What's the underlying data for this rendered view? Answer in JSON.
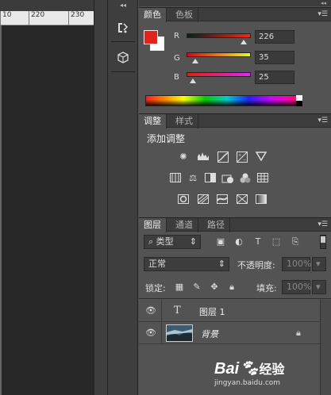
{
  "ruler": {
    "ticks": [
      "10",
      "220",
      "230"
    ]
  },
  "dock": {
    "grip": "◂◂"
  },
  "color_panel": {
    "tabs": [
      "颜色",
      "色板"
    ],
    "active_tab": 0,
    "foreground": "#e22319",
    "background": "#ffffff",
    "channels": [
      {
        "label": "R",
        "value": "226",
        "fraction": 0.886,
        "gradient": "linear-gradient(to right, #002319, #ff2319)"
      },
      {
        "label": "G",
        "value": "35",
        "fraction": 0.137,
        "gradient": "linear-gradient(to right, #e20019, #e2ff19)"
      },
      {
        "label": "B",
        "value": "25",
        "fraction": 0.098,
        "gradient": "linear-gradient(to right, #e22300, #e223ff)"
      }
    ]
  },
  "adjust_panel": {
    "tabs": [
      "调整",
      "样式"
    ],
    "active_tab": 0,
    "title": "添加调整",
    "icons_row1": [
      "brightness-icon",
      "levels-icon",
      "curves-icon",
      "exposure-icon",
      "vibrance-icon"
    ],
    "icons_row2": [
      "hue-saturation-icon",
      "color-balance-icon",
      "black-white-icon",
      "photo-filter-icon",
      "channel-mixer-icon",
      "color-lookup-icon"
    ],
    "icons_row3": [
      "invert-icon",
      "posterize-icon",
      "threshold-icon",
      "selective-color-icon",
      "gradient-map-icon"
    ]
  },
  "layers_panel": {
    "tabs": [
      "图层",
      "通道",
      "路径"
    ],
    "active_tab": 0,
    "filter_kind": "类型",
    "blend_mode": "正常",
    "opacity_label": "不透明度:",
    "opacity_value": "100%",
    "lock_label": "锁定:",
    "fill_label": "填充:",
    "fill_value": "100%",
    "layers": [
      {
        "name": "图层 1",
        "type": "text",
        "icon": "T"
      },
      {
        "name": "背景",
        "type": "image",
        "locked": true
      }
    ]
  },
  "watermark": {
    "brand": "Bai",
    "brand_cn": "经验",
    "url": "jingyan.baidu.com"
  },
  "colors": {
    "panel_bg": "#535353",
    "header_bg": "#3c3c3c",
    "canvas_bg": "#282828"
  }
}
